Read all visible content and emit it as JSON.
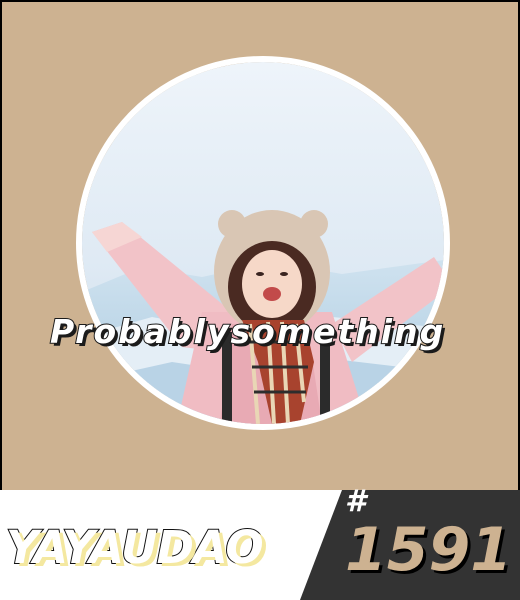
{
  "card": {
    "background_color": "#cdb291",
    "caption": "Probablysomething",
    "brand": "YAYAUDAO",
    "hash_symbol": "#",
    "issue_number": "1591",
    "number_color": "#cdb291",
    "dark_panel_color": "#333333"
  },
  "photo": {
    "icon": "portrait-photo"
  }
}
